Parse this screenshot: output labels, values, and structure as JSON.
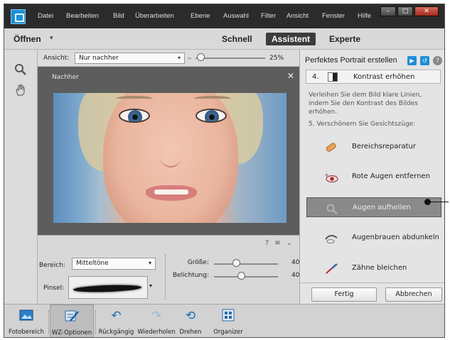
{
  "menubar": {
    "items": [
      "Datei",
      "Bearbeiten",
      "Bild",
      "Überarbeiten",
      "Ebene",
      "Auswahl",
      "Filter",
      "Ansicht",
      "Fenster",
      "Hilfe"
    ],
    "window_buttons": [
      "–",
      "□",
      "✕"
    ]
  },
  "modebar": {
    "open_label": "Öffnen",
    "open_caret": "▾",
    "tabs": [
      {
        "label": "Schnell",
        "active": false
      },
      {
        "label": "Assistent",
        "active": true
      },
      {
        "label": "Experte",
        "active": false
      }
    ]
  },
  "toolbox": {
    "tools": [
      "zoom-tool",
      "hand-tool"
    ]
  },
  "editor": {
    "view_label": "Ansicht:",
    "view_value": "Nur nachher",
    "zoom_percent": "25%",
    "view_title": "Nachher",
    "close_glyph": "✕"
  },
  "controls": {
    "icons": [
      "?",
      "≡",
      "⌄"
    ],
    "bereich_label": "Bereich:",
    "bereich_value": "Mitteltöne",
    "pinsel_label": "Pinsel:",
    "groesse_label": "Größe:",
    "groesse_value": "40",
    "belichtung_label": "Belichtung:",
    "belichtung_value": "40"
  },
  "panel": {
    "title": "Perfektes Portrait erstellen",
    "step4_number": "4.",
    "step4_label": "Kontrast erhöhen",
    "description": "Verleihen Sie dem Bild klare Linien, indem Sie den Kontrast des Bildes erhöhen.",
    "section_label": "5. Verschönern Sie Gesichtszüge:",
    "actions": [
      {
        "label": "Bereichsreparatur",
        "icon": "bandage-icon",
        "highlighted": false
      },
      {
        "label": "Rote Augen entfernen",
        "icon": "red-eye-icon",
        "highlighted": false
      },
      {
        "label": "Augen aufhellen",
        "icon": "eye-brighten-icon",
        "highlighted": true
      },
      {
        "label": "Augenbrauen abdunkeln",
        "icon": "eyebrow-icon",
        "highlighted": false
      },
      {
        "label": "Zähne bleichen",
        "icon": "whiten-teeth-icon",
        "highlighted": false
      }
    ],
    "buttons": {
      "done": "Fertig",
      "cancel": "Abbrechen"
    }
  },
  "bottombar": {
    "items": [
      {
        "label": "Fotobereich",
        "icon": "photo-bin-icon"
      },
      {
        "label": "WZ-Optionen",
        "icon": "tool-options-icon"
      },
      {
        "label": "Rückgängig",
        "icon": "undo-icon"
      },
      {
        "label": "Wiederholen",
        "icon": "redo-icon"
      },
      {
        "label": "Drehen",
        "icon": "rotate-icon"
      },
      {
        "label": "Organizer",
        "icon": "organizer-icon"
      }
    ]
  },
  "colors": {
    "menubar_bg": "#2b2b2b",
    "active_tab_bg": "#3c3c3c",
    "accent_blue": "#1f8fd6",
    "highlight_action_bg": "#8a8a8a"
  }
}
